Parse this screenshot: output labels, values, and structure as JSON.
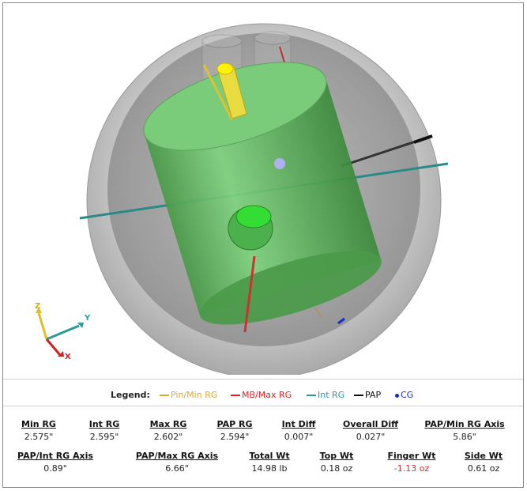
{
  "axis_triad": {
    "z": "Z",
    "y": "Y",
    "x": "X"
  },
  "legend": {
    "title": "Legend:",
    "items": [
      {
        "label": "Pin/Min RG",
        "color": "#e0a830",
        "kind": "line"
      },
      {
        "label": "MB/Max RG",
        "color": "#e02020",
        "kind": "line"
      },
      {
        "label": "Int RG",
        "color": "#2a9a9a",
        "kind": "line"
      },
      {
        "label": "PAP",
        "color": "#111111",
        "kind": "line"
      },
      {
        "label": "CG",
        "color": "#1a2ad0",
        "kind": "dot"
      }
    ]
  },
  "stats_row1": [
    {
      "label": "Min RG",
      "value": "2.575\""
    },
    {
      "label": "Int RG",
      "value": "2.595\""
    },
    {
      "label": "Max RG",
      "value": "2.602\""
    },
    {
      "label": "PAP RG",
      "value": "2.594\""
    },
    {
      "label": "Int Diff",
      "value": "0.007\""
    },
    {
      "label": "Overall Diff",
      "value": "0.027\""
    },
    {
      "label": "PAP/Min RG Axis",
      "value": "5.86\""
    }
  ],
  "stats_row2": [
    {
      "label": "PAP/Int RG Axis",
      "value": "0.89\""
    },
    {
      "label": "PAP/Max RG Axis",
      "value": "6.66\""
    },
    {
      "label": "Total Wt",
      "value": "14.98 lb"
    },
    {
      "label": "Top Wt",
      "value": "0.18 oz"
    },
    {
      "label": "Finger Wt",
      "value": "-1.13 oz",
      "negative": true
    },
    {
      "label": "Side Wt",
      "value": "0.61 oz"
    }
  ]
}
